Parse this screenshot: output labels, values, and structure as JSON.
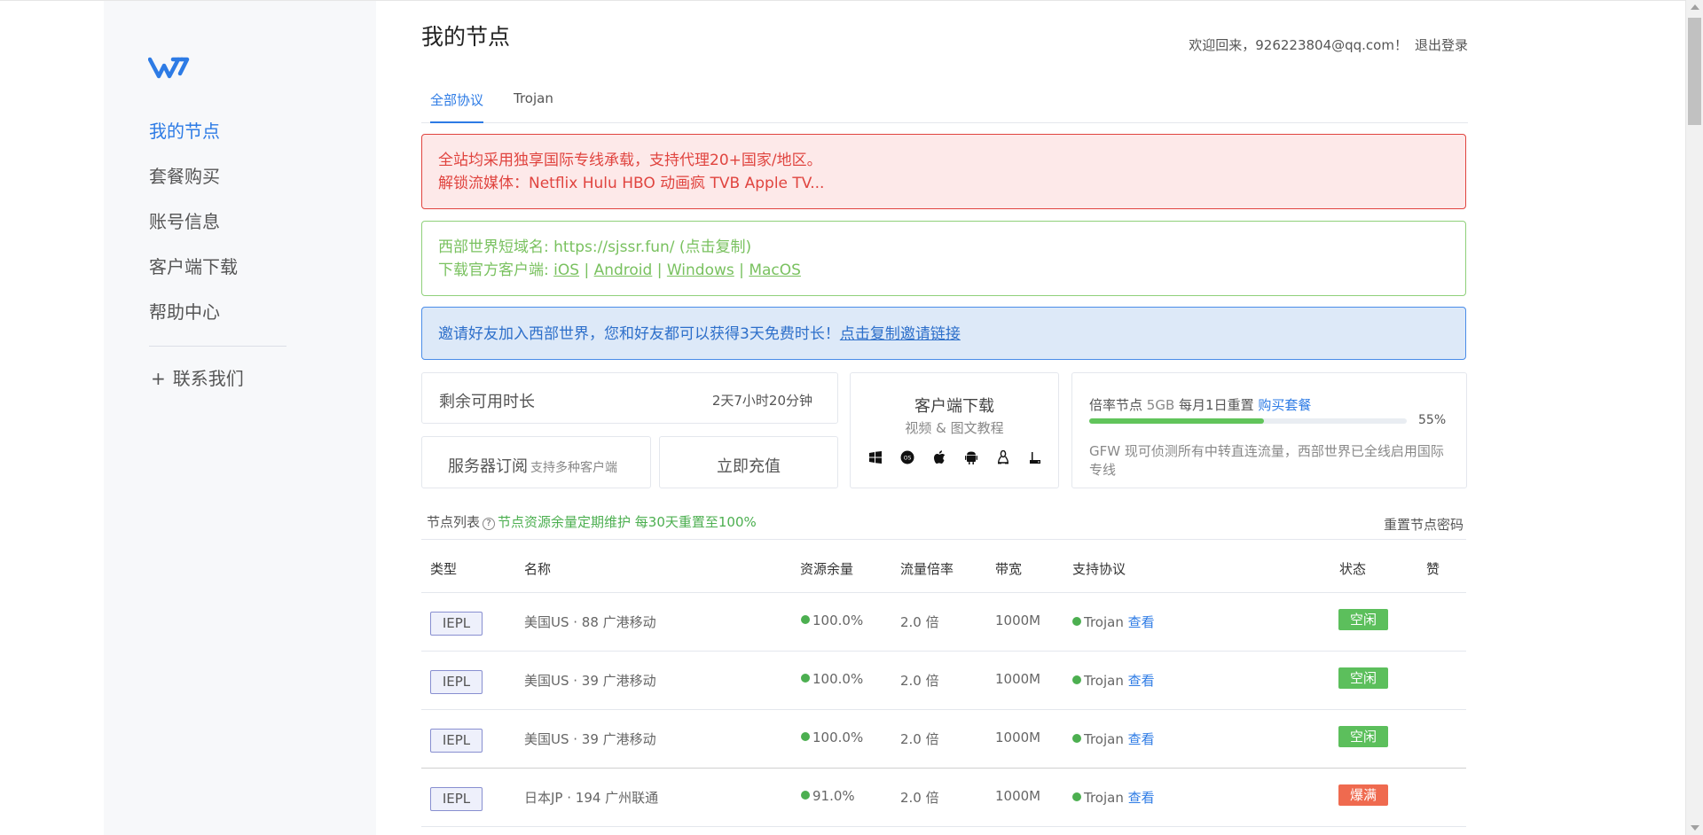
{
  "sidebar": {
    "logo_icon": "w-logo-icon",
    "items": [
      {
        "label": "我的节点"
      },
      {
        "label": "套餐购买"
      },
      {
        "label": "账号信息"
      },
      {
        "label": "客户端下载"
      },
      {
        "label": "帮助中心"
      }
    ],
    "contact": {
      "plus": "+",
      "label": "联系我们"
    }
  },
  "header": {
    "title": "我的节点",
    "welcome": "欢迎回来，926223804@qq.com！",
    "logout": "退出登录"
  },
  "tabs": [
    {
      "label": "全部协议"
    },
    {
      "label": "Trojan"
    }
  ],
  "alerts": {
    "red": {
      "line1": "全站均采用独享国际专线承载，支持代理20+国家/地区。",
      "line2": "解锁流媒体：Netflix Hulu HBO 动画疯 TVB Apple TV..."
    },
    "green": {
      "domain_prefix": "西部世界短域名: ",
      "domain_url": "https://sjssr.fun/",
      "domain_copy": " (点击复制)",
      "download_prefix": "下载官方客户端: ",
      "ios": "iOS",
      "android": "Android",
      "windows": "Windows",
      "macos": "MacOS",
      "sep": " | "
    },
    "blue": {
      "text": "邀请好友加入西部世界，您和好友都可以获得3天免费时长！",
      "link": "点击复制邀请链接"
    }
  },
  "cards": {
    "remain": {
      "label": "剩余可用时长",
      "value": "2天7小时20分钟"
    },
    "subscribe": {
      "label": "服务器订阅",
      "hint": "支持多种客户端"
    },
    "charge": {
      "label": "立即充值"
    },
    "client": {
      "title": "客户端下载",
      "subtitle": "视频 & 图文教程",
      "icons": [
        "windows-icon",
        "macos-icon",
        "apple-icon",
        "android-icon",
        "linux-icon",
        "router-icon"
      ]
    },
    "traffic": {
      "label": "倍率节点",
      "amount": "5GB",
      "reset": "每月1日重置",
      "buy": "购买套餐",
      "progress_percent": 55,
      "percent_label": "55%",
      "note": "GFW 现可侦测所有中转直连流量，西部世界已全线启用国际专线"
    }
  },
  "node_list": {
    "title": "节点列表",
    "help_icon": "question-icon",
    "help_mark": "?",
    "notice": "节点资源余量定期维护 每30天重置至100%",
    "reset_label": "重置节点密码",
    "columns": [
      "类型",
      "名称",
      "资源余量",
      "流量倍率",
      "带宽",
      "支持协议",
      "状态",
      "赞"
    ],
    "rows": [
      {
        "type": "IEPL",
        "name": "美国US · 88 广港移动",
        "remain": "100.0%",
        "rate": "2.0 倍",
        "bandwidth": "1000M",
        "protocol": "Trojan",
        "view": "查看",
        "status": "空闲",
        "status_kind": "idle"
      },
      {
        "type": "IEPL",
        "name": "美国US · 39 广港移动",
        "remain": "100.0%",
        "rate": "2.0 倍",
        "bandwidth": "1000M",
        "protocol": "Trojan",
        "view": "查看",
        "status": "空闲",
        "status_kind": "idle"
      },
      {
        "type": "IEPL",
        "name": "美国US · 39 广港移动",
        "remain": "100.0%",
        "rate": "2.0 倍",
        "bandwidth": "1000M",
        "protocol": "Trojan",
        "view": "查看",
        "status": "空闲",
        "status_kind": "idle"
      },
      {
        "type": "IEPL",
        "name": "日本JP · 194 广州联通",
        "remain": "91.0%",
        "rate": "2.0 倍",
        "bandwidth": "1000M",
        "protocol": "Trojan",
        "view": "查看",
        "status": "爆满",
        "status_kind": "full"
      }
    ]
  },
  "colors": {
    "accent": "#2d7be5",
    "idle": "#5cbf5c",
    "full": "#ef6a4f",
    "progress": "#61c45b"
  }
}
